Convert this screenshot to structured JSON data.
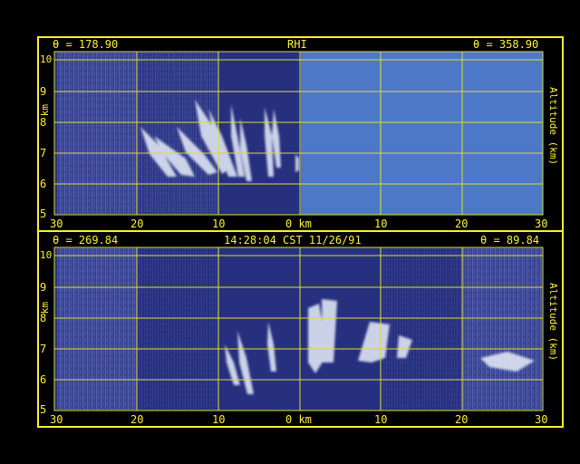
{
  "colors": {
    "background": "#000000",
    "frame": "#ffee33",
    "grid": "#dddd33",
    "panel_fill": "#26307f",
    "no_data_fill": "#4d78c8",
    "echo": "#e8eef8"
  },
  "top_panel": {
    "left_angle": "θ = 178.90",
    "title": "RHI",
    "right_angle": "θ = 358.90",
    "x_ticks": [
      "30",
      "20",
      "10",
      "0 km",
      "10",
      "20",
      "30"
    ],
    "y_ticks": [
      "5",
      "6",
      "7",
      "8",
      "9",
      "10"
    ],
    "left_unit": "km",
    "right_axis_label": "Altitude (km)"
  },
  "bottom_panel": {
    "left_angle": "θ = 269.84",
    "timestamp": "14:28:04 CST 11/26/91",
    "right_angle": "θ = 89.84",
    "x_ticks": [
      "30",
      "20",
      "10",
      "0 km",
      "10",
      "20",
      "30"
    ],
    "y_ticks": [
      "5",
      "6",
      "7",
      "8",
      "9",
      "10"
    ],
    "left_unit": "km",
    "right_axis_label": "Altitude (km)"
  }
}
